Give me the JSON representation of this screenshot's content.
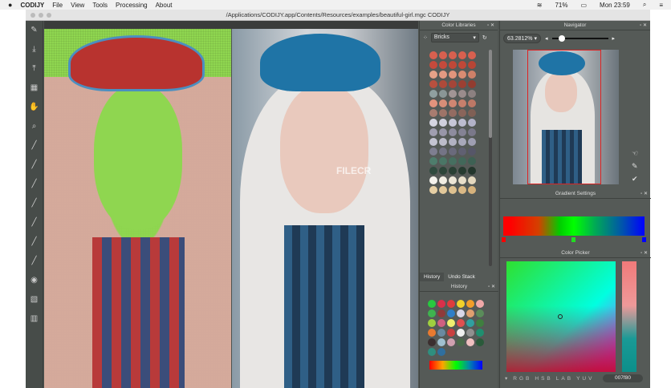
{
  "menubar": {
    "apple": "",
    "app": "CODIJY",
    "items": [
      "File",
      "View",
      "Tools",
      "Processing",
      "About"
    ],
    "battery": "71%",
    "clock": "Mon 23:59"
  },
  "window": {
    "title": "/Applications/CODIJY.app/Contents/Resources/examples/beautiful-girl.mgc CODIJY"
  },
  "toolbar": {
    "tools": [
      "palette",
      "import",
      "export",
      "mask",
      "hand",
      "zoom",
      "pen",
      "brush",
      "brush2",
      "brush3",
      "eraser",
      "pipette",
      "pencil",
      "eye",
      "fill",
      "clear"
    ]
  },
  "watermark": "FILECR",
  "color_libraries": {
    "title": "Color Libraries",
    "library": "Bricks",
    "swatches": [
      "#d9604f",
      "#d9604f",
      "#d9604f",
      "#d9604f",
      "#d9604f",
      "#c54a3c",
      "#c54a3c",
      "#c04838",
      "#c04838",
      "#b84535",
      "#e6a288",
      "#e39a82",
      "#e0957c",
      "#d88c72",
      "#cf8068",
      "#b8503f",
      "#ae4a3a",
      "#a54538",
      "#9c4033",
      "#923c30",
      "#90a0a0",
      "#8a9696",
      "#a29595",
      "#9a8c8c",
      "#8c8080",
      "#e3937d",
      "#d88e78",
      "#cf8672",
      "#c67f6c",
      "#bd7866",
      "#a87c70",
      "#9e7468",
      "#946c62",
      "#8a655b",
      "#806055",
      "#d6d6e2",
      "#d0d0de",
      "#c6c6d6",
      "#bcbccf",
      "#b2b2c8",
      "#a09eb0",
      "#9896a8",
      "#8e8c9e",
      "#848294",
      "#7a788a",
      "#c4c4d2",
      "#bcbcca",
      "#b2b2c2",
      "#a8a8ba",
      "#9e9eb2",
      "#7e7e90",
      "#747486",
      "#6a6a7c",
      "#606072",
      "#565668",
      "#4e7d6c",
      "#4a7666",
      "#466f60",
      "#42685a",
      "#3e6154",
      "#2f4a3e",
      "#2c4539",
      "#294034",
      "#263b30",
      "#23362c",
      "#f4f2ec",
      "#f0ede2",
      "#ece6d6",
      "#e8dfca",
      "#e4d8be",
      "#e6cfa4",
      "#e2c89a",
      "#dec190",
      "#dab986",
      "#d6b27c"
    ]
  },
  "history_panel": {
    "tabs": [
      "History",
      "Undo Stack"
    ],
    "title": "History",
    "colors": [
      "#27c93f",
      "#d9304a",
      "#e03c3c",
      "#f2d22a",
      "#f29e2a",
      "#f0a8a8",
      "#3fb34f",
      "#8f3a3a",
      "#2f7fc8",
      "#d7d7e8",
      "#e0a070",
      "#5a8c5a",
      "#9fcf3f",
      "#d06080",
      "#f0f070",
      "#e05050",
      "#30a0a0",
      "#3f7f3f",
      "#e87a30",
      "#6a8aa0",
      "#c84040",
      "#f0f0f0",
      "#909090",
      "#1f8f6f",
      "#3b2f2f",
      "#a0c0d0",
      "#d0a0b0",
      "#4a6a4a",
      "#f0c0c0",
      "#2a5a3a",
      "#2f8f7f",
      "#2f6f9f"
    ]
  },
  "navigator": {
    "title": "Navigator",
    "zoom": "63.2812%"
  },
  "gradient_settings": {
    "title": "Gradient Settings",
    "stops": [
      "#ff0000",
      "#22dd22",
      "#0000ff"
    ]
  },
  "color_picker": {
    "title": "Color Picker",
    "modes": [
      "R",
      "G",
      "B",
      "H",
      "S",
      "B",
      "L",
      "A",
      "B",
      "Y",
      "U",
      "V"
    ],
    "hex": "007f80"
  }
}
